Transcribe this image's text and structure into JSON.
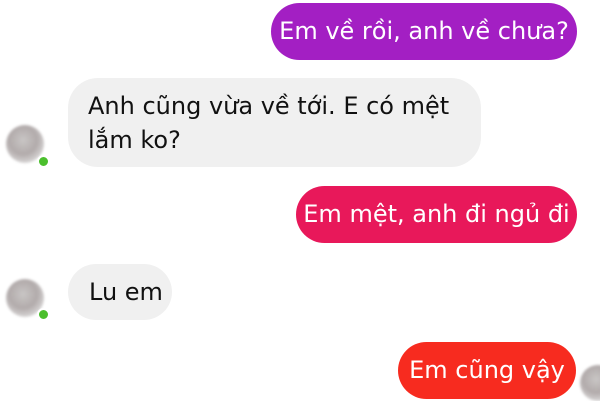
{
  "messages": [
    {
      "direction": "outgoing",
      "text": "Em về rồi, anh về chưa?",
      "color": "#a31fc3"
    },
    {
      "direction": "incoming",
      "text": "Anh cũng vừa về tới. E có mệt lắm ko?"
    },
    {
      "direction": "outgoing",
      "text": "Em mệt, anh đi ngủ đi",
      "color": "#e8185a"
    },
    {
      "direction": "incoming",
      "text": "Lu em"
    },
    {
      "direction": "outgoing",
      "text": "Em cũng vậy",
      "color": "#f72b1f"
    }
  ],
  "colors": {
    "incoming_bubble": "#f0f0f0",
    "online_indicator": "#4bbf2d"
  }
}
